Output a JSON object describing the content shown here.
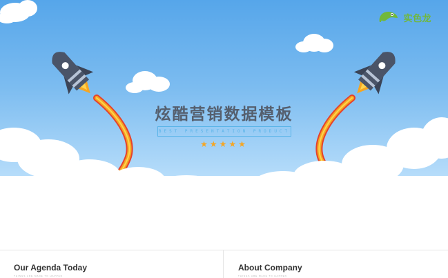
{
  "slide": {
    "title": "炫酷营销数据模板",
    "subtitle": "BEST PRESENTATION PRODUCT",
    "stars": "★★★★★",
    "accent_color": "#5ab4e8",
    "star_color": "#f5a623"
  },
  "logo": {
    "text": "实色龙",
    "icon": "chameleon-icon"
  },
  "bottom_cards": [
    {
      "title": "Our Agenda Today",
      "subtitle": "THINGS ARE MADE TO HAPPEN"
    },
    {
      "title": "About Company",
      "subtitle": "THINGS ARE MADE TO HAPPEN"
    }
  ]
}
